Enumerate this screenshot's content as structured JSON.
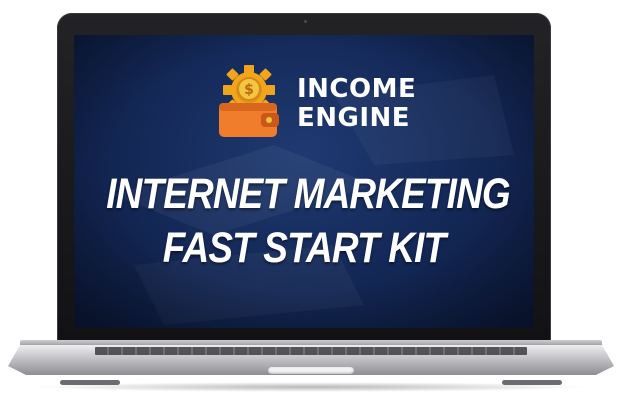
{
  "logo": {
    "line1": "INCOME",
    "line2": "ENGINE"
  },
  "headline": {
    "line1": "INTERNET MARKETING",
    "line2": "FAST START KIT"
  },
  "colors": {
    "screen_background": "#132755",
    "gear": "#f2a51a",
    "wallet": "#ef7d2c",
    "coin": "#f5c542",
    "text": "#ffffff"
  },
  "icons": [
    "gear-icon",
    "wallet-icon",
    "dollar-coin-icon"
  ]
}
